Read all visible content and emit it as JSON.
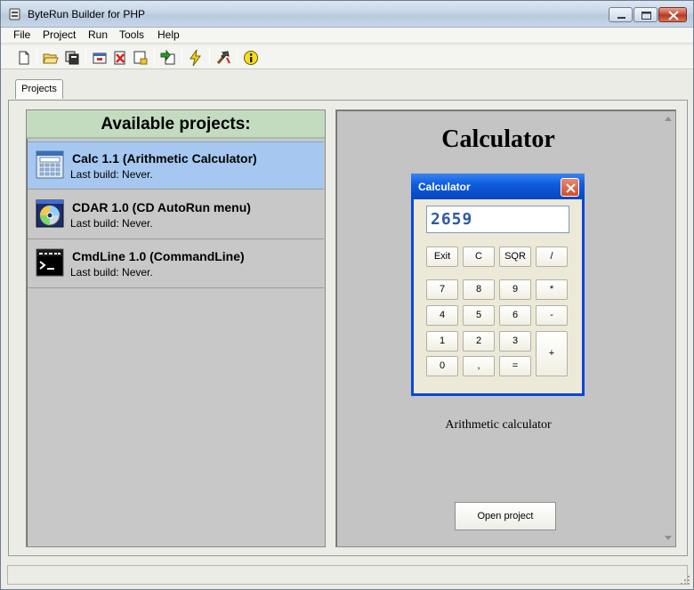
{
  "window": {
    "title": "ByteRun Builder for PHP"
  },
  "menu": [
    "File",
    "Project",
    "Run",
    "Tools",
    "Help"
  ],
  "toolbar": {
    "icons": [
      "new-file-icon",
      "open-folder-icon",
      "copy-icon",
      "run-window-icon",
      "delete-icon",
      "properties-icon",
      "import-icon",
      "build-lightning-icon",
      "tools-icon",
      "info-icon"
    ]
  },
  "tabs": [
    "Projects"
  ],
  "projects_panel": {
    "header": "Available projects:",
    "items": [
      {
        "name": "Calc 1.1 (Arithmetic Calculator)",
        "build": "Last build: Never.",
        "icon": "calculator-app-icon",
        "selected": true
      },
      {
        "name": "CDAR 1.0 (CD AutoRun menu)",
        "build": "Last build: Never.",
        "icon": "cd-disc-icon",
        "selected": false
      },
      {
        "name": "CmdLine 1.0 (CommandLine)",
        "build": "Last build: Never.",
        "icon": "command-line-icon",
        "selected": false
      }
    ]
  },
  "preview": {
    "title": "Calculator",
    "caption": "Arithmetic calculator",
    "open_button": "Open project",
    "calculator": {
      "window_title": "Calculator",
      "display": "2659",
      "keys": {
        "exit": "Exit",
        "clear": "C",
        "sqr": "SQR",
        "div": "/",
        "k7": "7",
        "k8": "8",
        "k9": "9",
        "mul": "*",
        "k4": "4",
        "k5": "5",
        "k6": "6",
        "sub": "-",
        "k1": "1",
        "k2": "2",
        "k3": "3",
        "add": "+",
        "k0": "0",
        "dot": ",",
        "eq": "="
      }
    }
  },
  "colors": {
    "selected_row": "#a6c8f0",
    "header_green": "#c3dcbf",
    "calc_frame": "#0a47d8"
  }
}
